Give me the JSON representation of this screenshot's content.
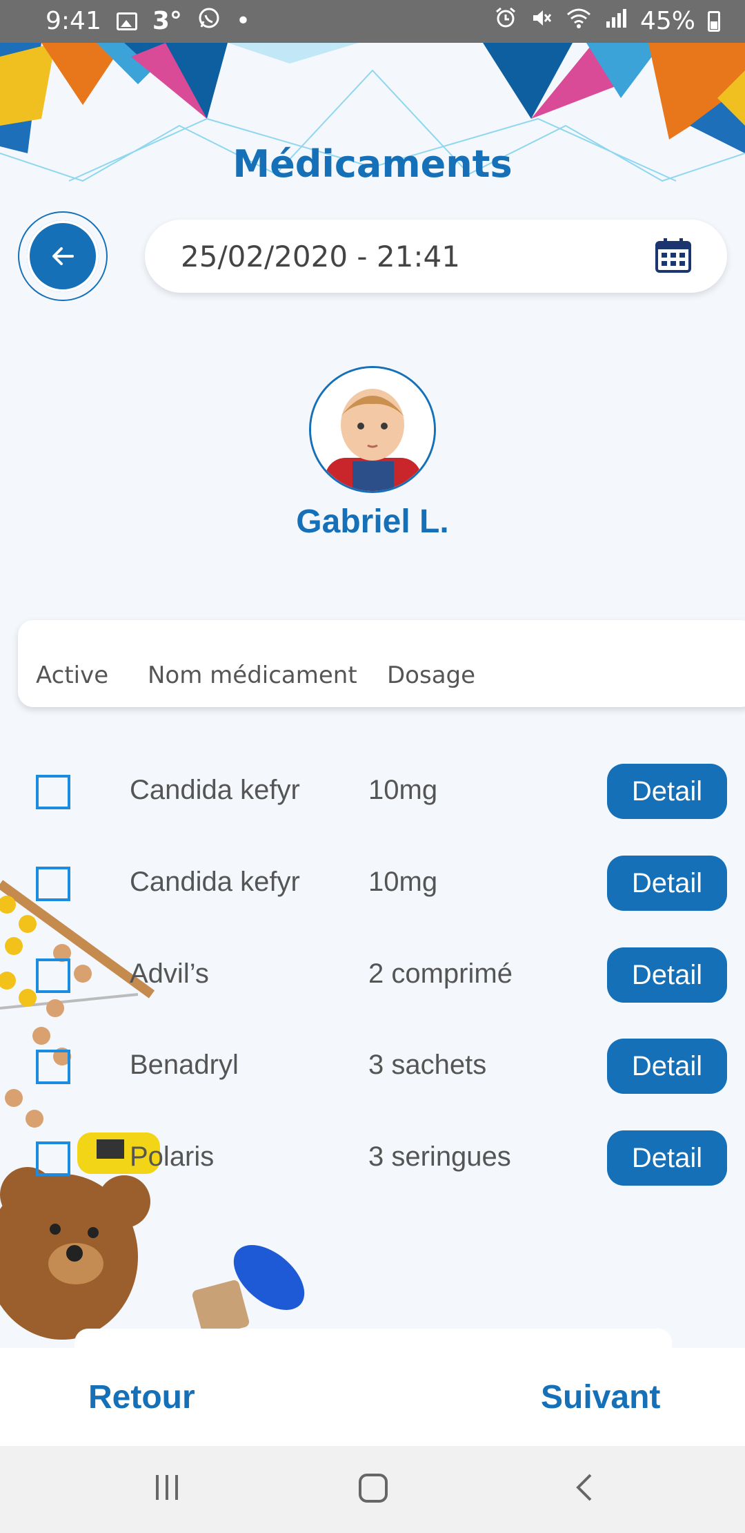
{
  "status_bar": {
    "time": "9:41",
    "temperature": "3°",
    "battery": "45%",
    "icons": [
      "image-icon",
      "whatsapp-icon",
      "alarm-icon",
      "mute-icon",
      "wifi-icon",
      "signal-icon",
      "battery-icon"
    ]
  },
  "header": {
    "title": "Médicaments",
    "date_value": "25/02/2020 - 21:41"
  },
  "profile": {
    "name": "Gabriel L."
  },
  "table": {
    "columns": [
      "Active",
      "Nom médicament",
      "Dosage"
    ],
    "rows": [
      {
        "name": "Candida kefyr",
        "dosage": "10mg",
        "action": "Detail",
        "active": false
      },
      {
        "name": "Candida kefyr",
        "dosage": "10mg",
        "action": "Detail",
        "active": false
      },
      {
        "name": "Advil’s",
        "dosage": "2 comprimé",
        "action": "Detail",
        "active": false
      },
      {
        "name": "Benadryl",
        "dosage": "3 sachets",
        "action": "Detail",
        "active": false
      },
      {
        "name": "Polaris",
        "dosage": "3 seringues",
        "action": "Detail",
        "active": false
      }
    ]
  },
  "footer": {
    "back_label": "Retour",
    "next_label": "Suivant"
  },
  "colors": {
    "primary": "#1570b8",
    "checkbox": "#1c8ce0",
    "background": "#f4f8fc"
  }
}
